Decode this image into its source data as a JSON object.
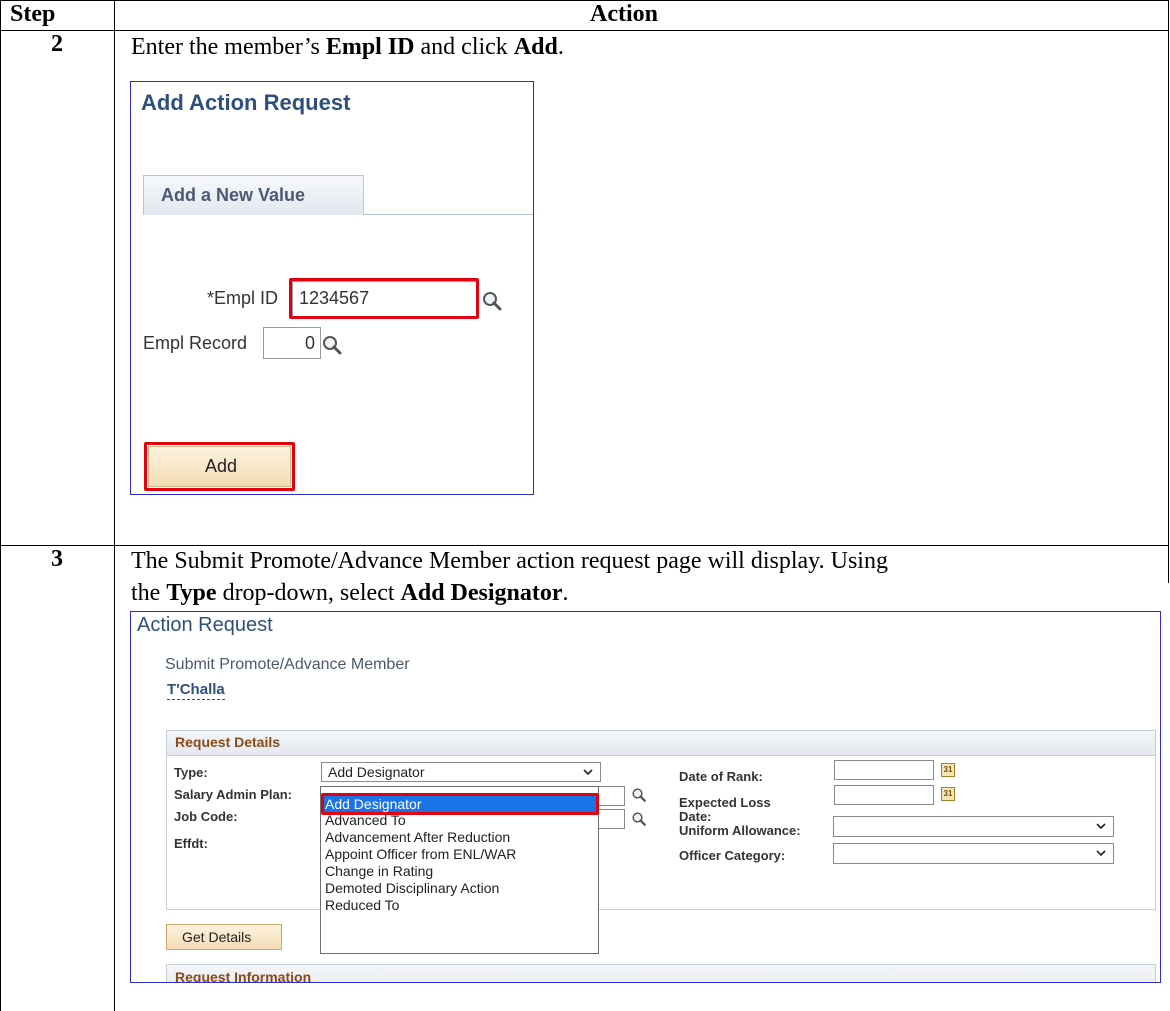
{
  "table": {
    "header_step": "Step",
    "header_action": "Action"
  },
  "rows": [
    {
      "step": "2",
      "instr_pre": "Enter the member’s ",
      "instr_b1": "Empl ID",
      "instr_mid": " and click ",
      "instr_b2": "Add",
      "instr_post": "."
    },
    {
      "step": "3",
      "line1": "The Submit Promote/Advance Member action request page will display. Using",
      "line2_pre": "the ",
      "line2_b1": "Type",
      "line2_mid": " drop-down, select ",
      "line2_b2": "Add Designator",
      "line2_post": "."
    }
  ],
  "add_request": {
    "title": "Add Action Request",
    "tab": "Add a New Value",
    "empl_id_label": "*Empl ID",
    "empl_id_value": "1234567",
    "empl_record_label": "Empl Record",
    "empl_record_value": "0",
    "add_button": "Add"
  },
  "action_request": {
    "title": "Action Request",
    "subtitle": "Submit Promote/Advance Member",
    "member_name": "T'Challa",
    "section_title": "Request Details",
    "labels": {
      "type": "Type:",
      "salary_admin_plan": "Salary Admin Plan:",
      "job_code": "Job Code:",
      "effdt": "Effdt:",
      "date_of_rank": "Date of Rank:",
      "expected_loss": "Expected Loss",
      "date": "Date:",
      "uniform_allowance": "Uniform Allowance:",
      "officer_category": "Officer Category:"
    },
    "type_value": "Add Designator",
    "dropdown_options": [
      "Add Designator",
      "Advanced To",
      "Advancement After Reduction",
      "Appoint Officer from ENL/WAR",
      "Change in Rating",
      "Demoted Disciplinary Action",
      "Reduced To"
    ],
    "calendar_glyph": "31",
    "get_details_button": "Get Details",
    "section2_title": "Request Information"
  }
}
